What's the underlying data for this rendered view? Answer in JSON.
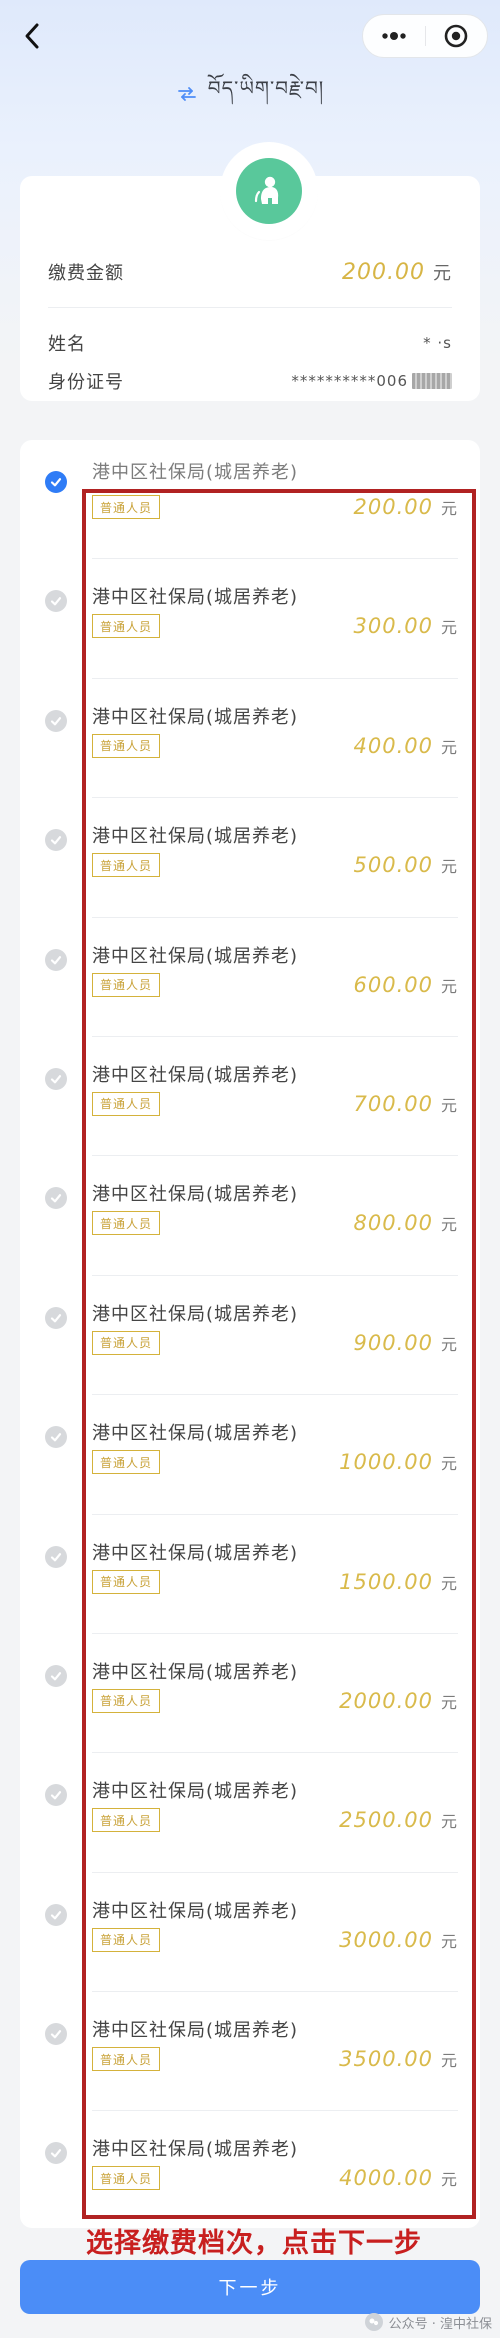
{
  "header": {
    "language_label": "བོད་ཡིག་བརྗེ་བ།"
  },
  "summary": {
    "amount_label": "缴费金额",
    "amount_value": "200.00",
    "amount_unit": "元",
    "name_label": "姓名",
    "name_value": "*  ·s",
    "id_label": "身份证号",
    "id_value": "**********006"
  },
  "options": [
    {
      "title": "港中区社保局(城居养老)",
      "tag": "普通人员",
      "amount": "200.00",
      "unit": "元",
      "selected": true
    },
    {
      "title": "港中区社保局(城居养老)",
      "tag": "普通人员",
      "amount": "300.00",
      "unit": "元",
      "selected": false
    },
    {
      "title": "港中区社保局(城居养老)",
      "tag": "普通人员",
      "amount": "400.00",
      "unit": "元",
      "selected": false
    },
    {
      "title": "港中区社保局(城居养老)",
      "tag": "普通人员",
      "amount": "500.00",
      "unit": "元",
      "selected": false
    },
    {
      "title": "港中区社保局(城居养老)",
      "tag": "普通人员",
      "amount": "600.00",
      "unit": "元",
      "selected": false
    },
    {
      "title": "港中区社保局(城居养老)",
      "tag": "普通人员",
      "amount": "700.00",
      "unit": "元",
      "selected": false
    },
    {
      "title": "港中区社保局(城居养老)",
      "tag": "普通人员",
      "amount": "800.00",
      "unit": "元",
      "selected": false
    },
    {
      "title": "港中区社保局(城居养老)",
      "tag": "普通人员",
      "amount": "900.00",
      "unit": "元",
      "selected": false
    },
    {
      "title": "港中区社保局(城居养老)",
      "tag": "普通人员",
      "amount": "1000.00",
      "unit": "元",
      "selected": false
    },
    {
      "title": "港中区社保局(城居养老)",
      "tag": "普通人员",
      "amount": "1500.00",
      "unit": "元",
      "selected": false
    },
    {
      "title": "港中区社保局(城居养老)",
      "tag": "普通人员",
      "amount": "2000.00",
      "unit": "元",
      "selected": false
    },
    {
      "title": "港中区社保局(城居养老)",
      "tag": "普通人员",
      "amount": "2500.00",
      "unit": "元",
      "selected": false
    },
    {
      "title": "港中区社保局(城居养老)",
      "tag": "普通人员",
      "amount": "3000.00",
      "unit": "元",
      "selected": false
    },
    {
      "title": "港中区社保局(城居养老)",
      "tag": "普通人员",
      "amount": "3500.00",
      "unit": "元",
      "selected": false
    },
    {
      "title": "港中区社保局(城居养老)",
      "tag": "普通人员",
      "amount": "4000.00",
      "unit": "元",
      "selected": false
    }
  ],
  "annotation": "选择缴费档次，点击下一步",
  "next_button_label": "下一步",
  "watermark": "公众号 · 湟中社保"
}
